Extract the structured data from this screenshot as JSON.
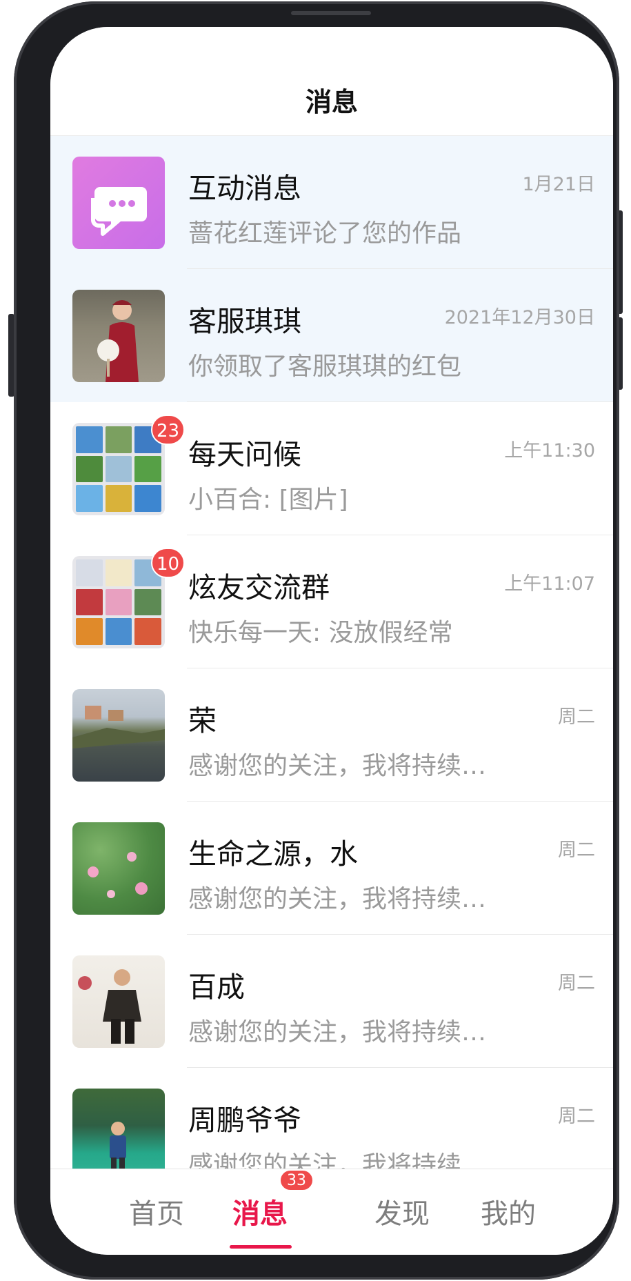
{
  "header": {
    "title": "消息"
  },
  "messages": [
    {
      "name": "互动消息",
      "preview": "蔷花红莲评论了您的作品",
      "time": "1月21日",
      "badge": "",
      "pinned": true,
      "avatar": "chat-bubble-icon"
    },
    {
      "name": "客服琪琪",
      "preview": "你领取了客服琪琪的红包",
      "time": "2021年12月30日",
      "badge": "",
      "pinned": true,
      "avatar": "woman-red-dress-photo"
    },
    {
      "name": "每天问候",
      "preview": "小百合: [图片]",
      "time": "上午11:30",
      "badge": "23",
      "pinned": false,
      "avatar": "group-photo-grid"
    },
    {
      "name": "炫友交流群",
      "preview": "快乐每一天: 没放假经常",
      "time": "上午11:07",
      "badge": "10",
      "pinned": false,
      "avatar": "group-photo-grid"
    },
    {
      "name": "荣",
      "preview": "感谢您的关注，我将持续…",
      "time": "周二",
      "badge": "",
      "pinned": false,
      "avatar": "coastal-village-photo"
    },
    {
      "name": "生命之源，水",
      "preview": "感谢您的关注，我将持续…",
      "time": "周二",
      "badge": "",
      "pinned": false,
      "avatar": "lotus-pond-photo"
    },
    {
      "name": "百成",
      "preview": "感谢您的关注，我将持续…",
      "time": "周二",
      "badge": "",
      "pinned": false,
      "avatar": "man-seated-photo"
    },
    {
      "name": "周鹏爷爷",
      "preview": "感谢您的关注，我将持续",
      "time": "周二",
      "badge": "",
      "pinned": false,
      "avatar": "child-garden-photo"
    }
  ],
  "tabs": [
    {
      "label": "首页",
      "active": false
    },
    {
      "label": "消息",
      "active": true,
      "badge": "33"
    },
    {
      "label": "发现",
      "active": false
    },
    {
      "label": "我的",
      "active": false
    }
  ],
  "colors": {
    "accent": "#e8174a",
    "badge": "#ef4a4a",
    "pinned_bg": "#f1f7fd"
  }
}
